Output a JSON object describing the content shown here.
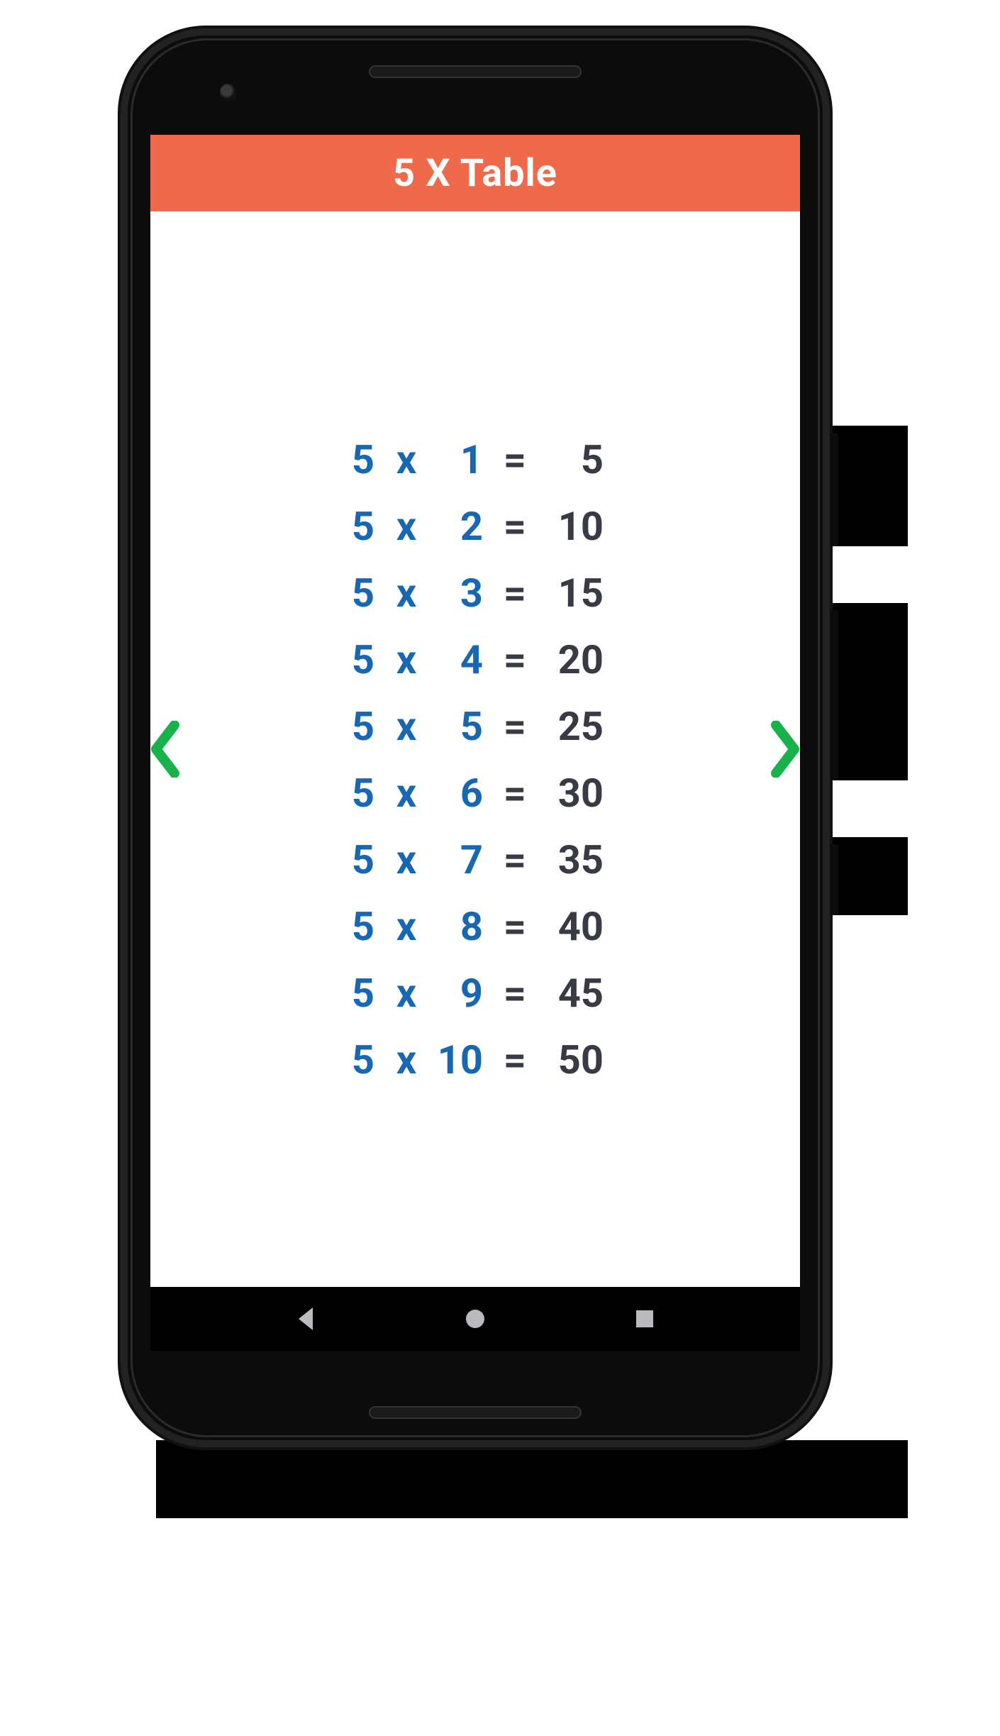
{
  "header": {
    "title": "5 X Table"
  },
  "colors": {
    "accent": "#ef6a4a",
    "blue": "#1867b3",
    "dark": "#383b44",
    "arrow": "#17b24a"
  },
  "nav": {
    "left_icon": "chevron-left-icon",
    "right_icon": "chevron-right-icon"
  },
  "symbols": {
    "x": "x",
    "eq": "="
  },
  "table": {
    "base": 5,
    "rows": [
      {
        "base": "5",
        "multiplier": "1",
        "result": "5"
      },
      {
        "base": "5",
        "multiplier": "2",
        "result": "10"
      },
      {
        "base": "5",
        "multiplier": "3",
        "result": "15"
      },
      {
        "base": "5",
        "multiplier": "4",
        "result": "20"
      },
      {
        "base": "5",
        "multiplier": "5",
        "result": "25"
      },
      {
        "base": "5",
        "multiplier": "6",
        "result": "30"
      },
      {
        "base": "5",
        "multiplier": "7",
        "result": "35"
      },
      {
        "base": "5",
        "multiplier": "8",
        "result": "40"
      },
      {
        "base": "5",
        "multiplier": "9",
        "result": "45"
      },
      {
        "base": "5",
        "multiplier": "10",
        "result": "50"
      }
    ]
  },
  "android_nav": {
    "back_icon": "nav-back-icon",
    "home_icon": "nav-home-icon",
    "recent_icon": "nav-recent-icon"
  }
}
